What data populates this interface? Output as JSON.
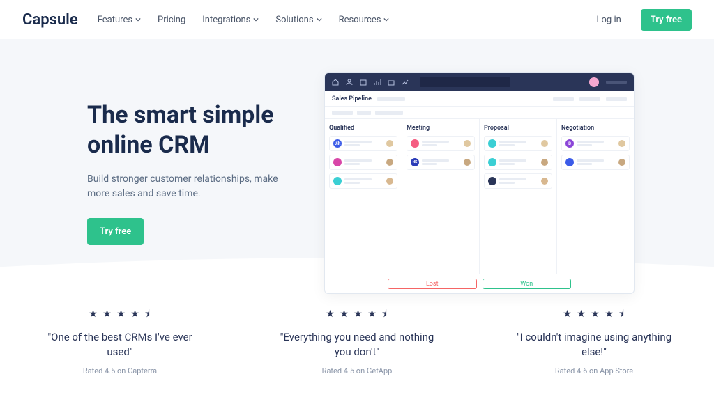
{
  "nav": {
    "logo": "Capsule",
    "links": [
      "Features",
      "Pricing",
      "Integrations",
      "Solutions",
      "Resources"
    ],
    "login": "Log in",
    "try": "Try free"
  },
  "hero": {
    "title": "The smart simple online CRM",
    "sub": "Build stronger customer relationships, make more sales and save time.",
    "cta": "Try free"
  },
  "mock": {
    "breadcrumb": "Sales Pipeline",
    "cols": [
      "Qualified",
      "Meeting",
      "Proposal",
      "Negotiation"
    ],
    "lost": "Lost",
    "won": "Won"
  },
  "reviews": [
    {
      "quote": "\"One of the best CRMs I've ever used\"",
      "rated": "Rated 4.5 on Capterra"
    },
    {
      "quote": "\"Everything you need and nothing you don't\"",
      "rated": "Rated 4.5 on GetApp"
    },
    {
      "quote": "\"I couldn't imagine using anything else!\"",
      "rated": "Rated 4.6 on App Store"
    }
  ],
  "stars": "★ ★ ★ ★ ⯨"
}
